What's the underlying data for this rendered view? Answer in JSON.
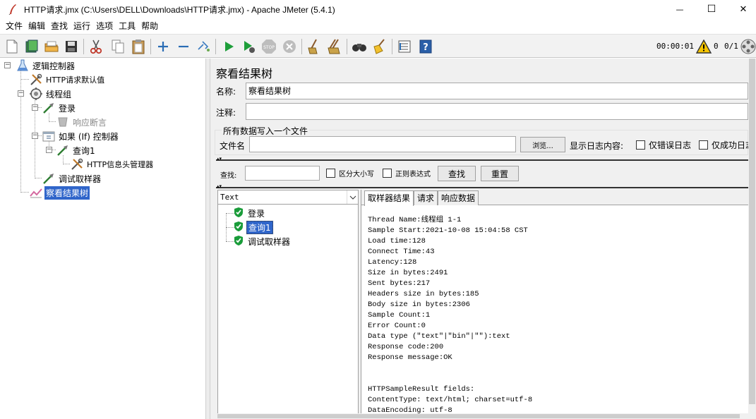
{
  "window": {
    "title": "HTTP请求.jmx (C:\\Users\\DELL\\Downloads\\HTTP请求.jmx) - Apache JMeter (5.4.1)",
    "minimize_glyph": "—",
    "maximize_glyph": "☐",
    "close_glyph": "✕"
  },
  "menu": [
    "文件",
    "编辑",
    "查找",
    "运行",
    "选项",
    "工具",
    "帮助"
  ],
  "toolbar": {
    "icons": [
      "new-icon",
      "templates-icon",
      "open-icon",
      "save-icon",
      "cut-icon",
      "copy-icon",
      "paste-icon",
      "expand-icon",
      "collapse-icon",
      "toggle-icon",
      "start-icon",
      "start-no-pause-icon",
      "stop-icon",
      "shutdown-icon",
      "clear-icon",
      "clear-all-icon",
      "search-icon",
      "reset-search-icon",
      "function-helper-icon",
      "help-icon"
    ],
    "timer": "00:00:01",
    "warning_count": "0",
    "thread_ratio": "0/1"
  },
  "tree": {
    "items": [
      {
        "label": "逻辑控制器",
        "icon": "test-plan-icon",
        "depth": 0
      },
      {
        "label": "HTTP请求默认值",
        "icon": "config-element-icon",
        "depth": 1
      },
      {
        "label": "线程组",
        "icon": "thread-group-icon",
        "depth": 1
      },
      {
        "label": "登录",
        "icon": "sampler-icon",
        "depth": 2
      },
      {
        "label": "响应断言",
        "icon": "assertion-icon",
        "depth": 3
      },
      {
        "label": "如果 (If) 控制器",
        "icon": "if-controller-icon",
        "depth": 2
      },
      {
        "label": "查询1",
        "icon": "sampler-icon",
        "depth": 3
      },
      {
        "label": "HTTP信息头管理器",
        "icon": "config-element-icon",
        "depth": 4
      },
      {
        "label": "调试取样器",
        "icon": "sampler-icon",
        "depth": 2
      },
      {
        "label": "察看结果树",
        "icon": "listener-icon",
        "depth": 1
      }
    ],
    "selected": "察看结果树"
  },
  "panel": {
    "title": "察看结果树",
    "name_label": "名称:",
    "name_value": "察看结果树",
    "comment_label": "注释:",
    "comment_value": "",
    "file_group_label": "所有数据写入一个文件",
    "filename_label": "文件名",
    "filename_value": "",
    "browse_button": "浏览...",
    "log_content_label": "显示日志内容:",
    "errors_only_label": "仅错误日志",
    "success_only_label": "仅成功日志",
    "search_label": "查找:",
    "search_value": "",
    "case_sensitive_label": "区分大小写",
    "regex_label": "正则表达式",
    "find_button": "查找",
    "reset_button": "重置"
  },
  "results": {
    "renderer": "Text",
    "samples": [
      {
        "label": "登录",
        "status": "success"
      },
      {
        "label": "查询1",
        "status": "success"
      },
      {
        "label": "调试取样器",
        "status": "success"
      }
    ],
    "selected_sample": "查询1",
    "tabs": [
      "取样器结果",
      "请求",
      "响应数据"
    ],
    "active_tab": "取样器结果",
    "sampler_result": "Thread Name:线程组 1-1\nSample Start:2021-10-08 15:04:58 CST\nLoad time:128\nConnect Time:43\nLatency:128\nSize in bytes:2491\nSent bytes:217\nHeaders size in bytes:185\nBody size in bytes:2306\nSample Count:1\nError Count:0\nData type (\"text\"|\"bin\"|\"\"):text\nResponse code:200\nResponse message:OK\n\n\nHTTPSampleResult fields:\nContentType: text/html; charset=utf-8\nDataEncoding: utf-8"
  },
  "colors": {
    "selection": "#2f65ca",
    "success": "#1a9c3a",
    "warning": "#f5c400"
  }
}
